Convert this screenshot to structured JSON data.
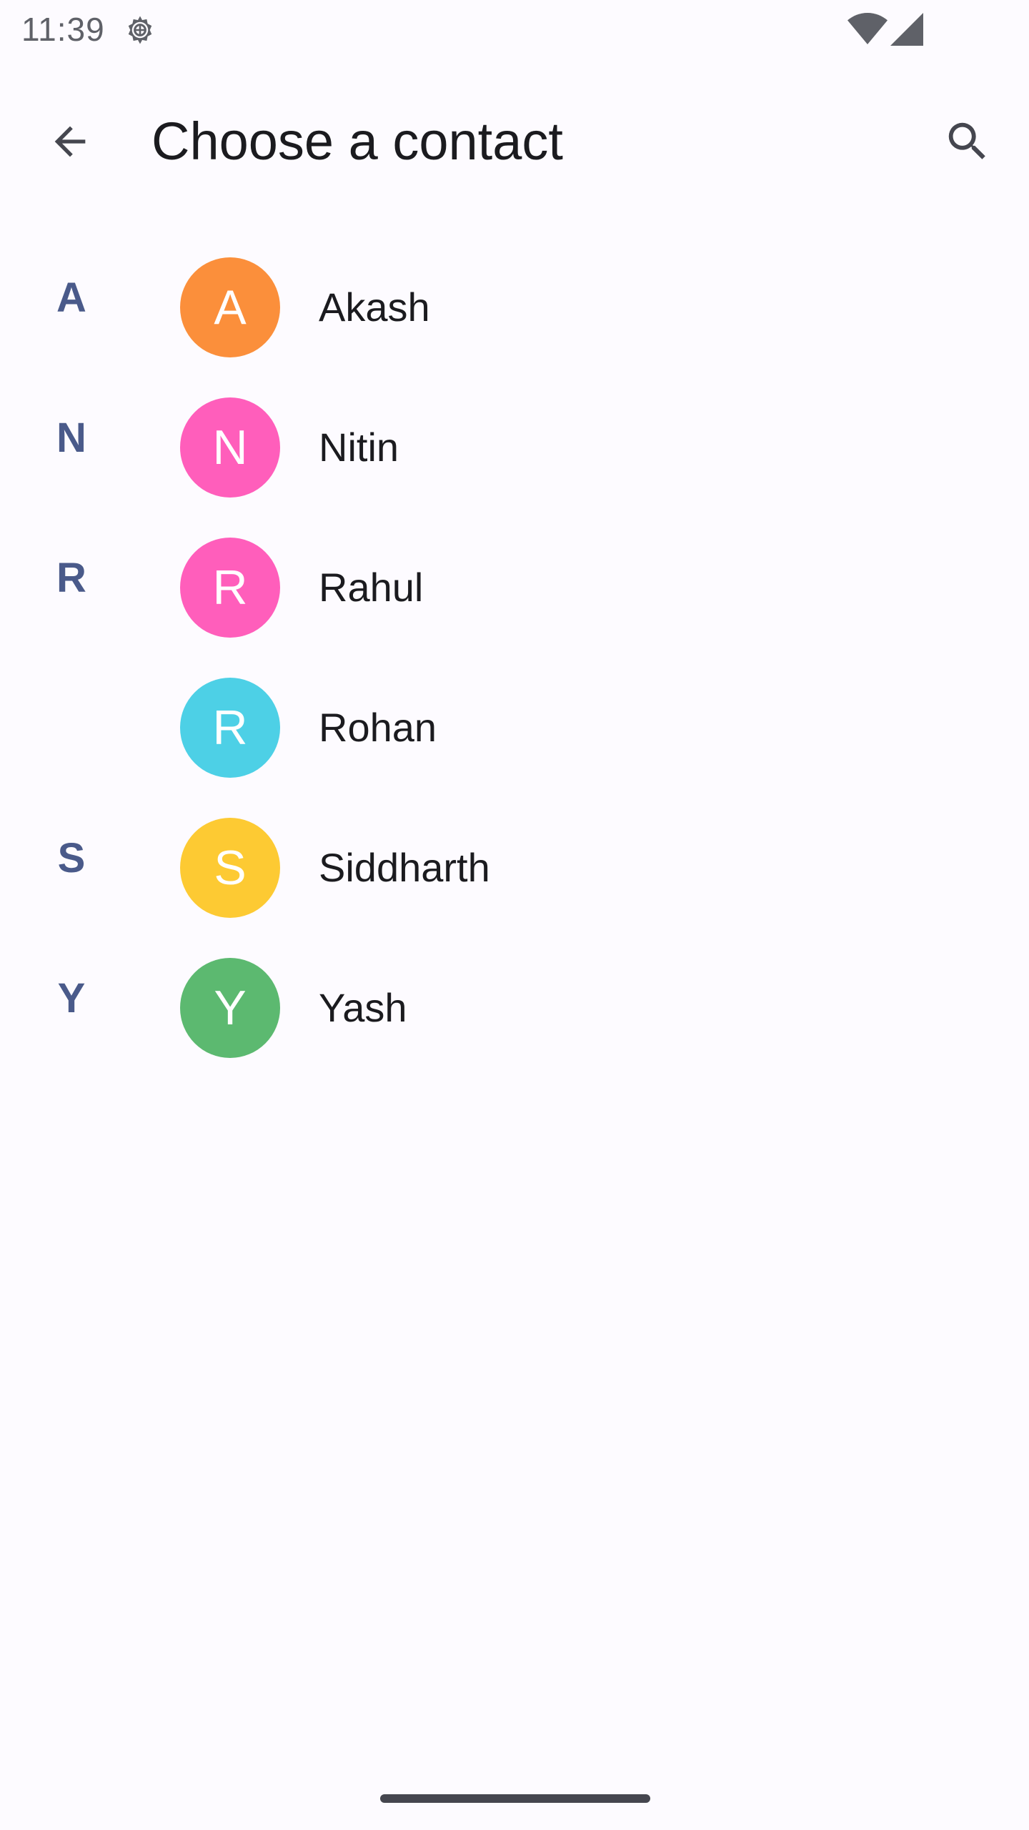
{
  "status_bar": {
    "time": "11:39",
    "icons": [
      "settings-gear-icon",
      "wifi-icon",
      "cell-signal-icon"
    ]
  },
  "app_bar": {
    "title": "Choose a contact",
    "back_icon": "arrow-back-icon",
    "search_icon": "search-icon"
  },
  "contacts": [
    {
      "section": "A",
      "initial": "A",
      "name": "Akash",
      "color": "#fb8f3b"
    },
    {
      "section": "N",
      "initial": "N",
      "name": "Nitin",
      "color": "#ff5ebb"
    },
    {
      "section": "R",
      "initial": "R",
      "name": "Rahul",
      "color": "#ff5ebb"
    },
    {
      "section": "",
      "initial": "R",
      "name": "Rohan",
      "color": "#4dd0e6"
    },
    {
      "section": "S",
      "initial": "S",
      "name": "Siddharth",
      "color": "#fdca33"
    },
    {
      "section": "Y",
      "initial": "Y",
      "name": "Yash",
      "color": "#5cb970"
    }
  ],
  "colors": {
    "background": "#fdfbff",
    "section_letter": "#4a5a8a",
    "text_primary": "#1b1b1f"
  }
}
